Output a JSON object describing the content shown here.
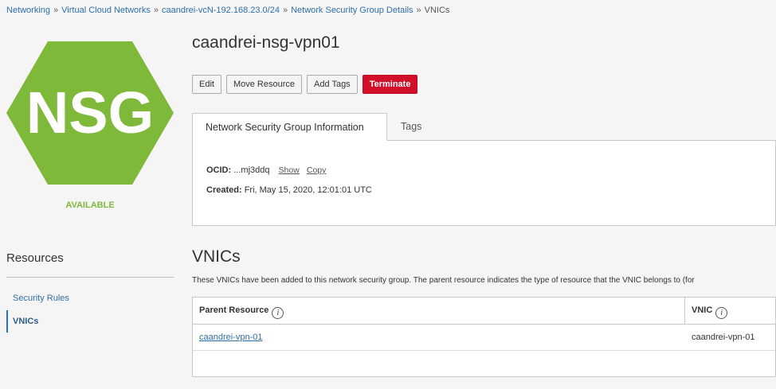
{
  "breadcrumb": {
    "items": [
      "Networking",
      "Virtual Cloud Networks",
      "caandrei-vcN-192.168.23.0/24",
      "Network Security Group Details",
      "VNICs"
    ],
    "separator": "»"
  },
  "resource": {
    "badge_text": "NSG",
    "badge_color": "#7fb93a",
    "status": "AVAILABLE",
    "title": "caandrei-nsg-vpn01"
  },
  "actions": {
    "edit": "Edit",
    "move": "Move Resource",
    "add_tags": "Add Tags",
    "terminate": "Terminate"
  },
  "tabs": {
    "info": "Network Security Group Information",
    "tags": "Tags"
  },
  "info": {
    "ocid_label": "OCID:",
    "ocid_value": "...mj3ddq",
    "show": "Show",
    "copy": "Copy",
    "created_label": "Created:",
    "created_value": "Fri, May 15, 2020, 12:01:01 UTC"
  },
  "sidebar": {
    "heading": "Resources",
    "items": [
      "Security Rules",
      "VNICs"
    ]
  },
  "vnics": {
    "title": "VNICs",
    "description": "These VNICs have been added to this network security group. The parent resource indicates the type of resource that the VNIC belongs to (for",
    "columns": [
      "Parent Resource",
      "VNIC"
    ],
    "rows": [
      {
        "parent": "caandrei-vpn-01",
        "vnic": "caandrei-vpn-01"
      }
    ]
  },
  "icons": {
    "info": "i"
  },
  "colors": {
    "link": "#2f6fa7",
    "danger": "#d20f2a",
    "status_green": "#7fb93a"
  }
}
